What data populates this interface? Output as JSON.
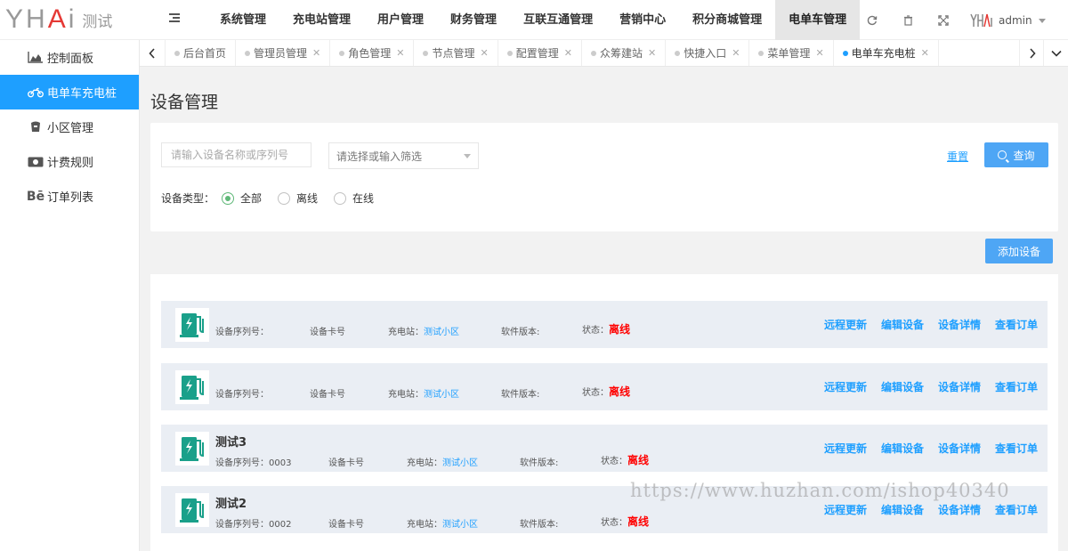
{
  "header": {
    "logo_mark": "YHAi",
    "logo_text": "测试",
    "nav": [
      "系统管理",
      "充电站管理",
      "用户管理",
      "财务管理",
      "互联互通管理",
      "营销中心",
      "积分商城管理",
      "电单车管理"
    ],
    "active_nav": "电单车管理",
    "user_name": "admin"
  },
  "sidebar": {
    "items": [
      {
        "label": "控制面板",
        "icon": "chart-area-icon"
      },
      {
        "label": "电单车充电桩",
        "icon": "motorcycle-icon"
      },
      {
        "label": "小区管理",
        "icon": "building-icon"
      },
      {
        "label": "计费规则",
        "icon": "money-icon"
      },
      {
        "label": "订单列表",
        "icon": "behance-icon"
      }
    ],
    "active_index": 1
  },
  "tabs": {
    "items": [
      "后台首页",
      "管理员管理",
      "角色管理",
      "节点管理",
      "配置管理",
      "众筹建站",
      "快捷入口",
      "菜单管理",
      "电单车充电桩"
    ],
    "active_index": 8
  },
  "page": {
    "title": "设备管理",
    "search_placeholder": "请输入设备名称或序列号",
    "select_placeholder": "请选择或输入筛选",
    "reset_label": "重置",
    "query_label": "查询",
    "type_label": "设备类型：",
    "radios": [
      "全部",
      "离线",
      "在线"
    ],
    "radio_checked": 0,
    "add_label": "添加设备"
  },
  "labels": {
    "serial": "设备序列号：",
    "card": "设备卡号",
    "station": "充电站：",
    "version": "软件版本:",
    "status": "状态："
  },
  "actions": [
    "远程更新",
    "编辑设备",
    "设备详情",
    "查看订单"
  ],
  "devices": [
    {
      "name": "",
      "serial": "",
      "station": "测试小区",
      "status": "离线"
    },
    {
      "name": "",
      "serial": "",
      "station": "测试小区",
      "status": "离线"
    },
    {
      "name": "测试3",
      "serial": "0003",
      "station": "测试小区",
      "status": "离线"
    },
    {
      "name": "测试2",
      "serial": "0002",
      "station": "测试小区",
      "status": "离线"
    }
  ],
  "watermark": "https://www.huzhan.com/ishop40340",
  "colors": {
    "primary": "#1e9fff",
    "button": "#4ea6f5",
    "offline": "#ff0000",
    "radio_checked": "#5fb878",
    "device_icon": "#1aa08a"
  }
}
